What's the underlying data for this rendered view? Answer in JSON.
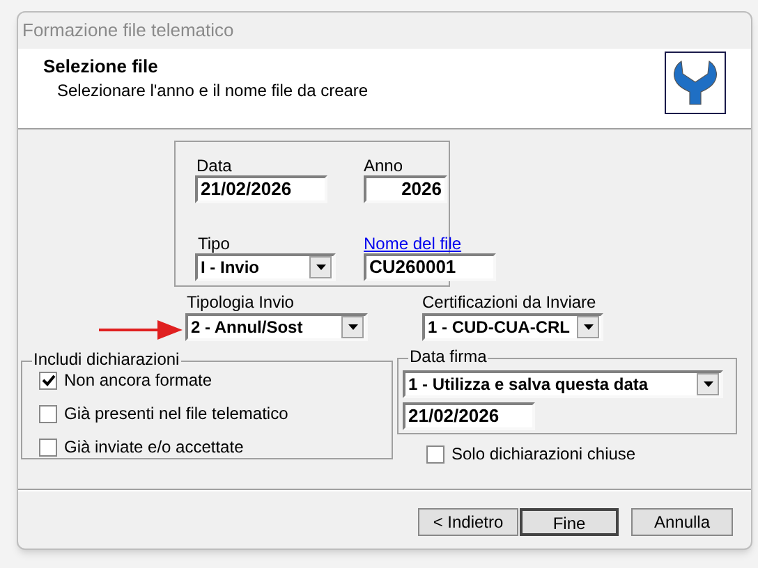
{
  "window": {
    "title": "Formazione file telematico"
  },
  "header": {
    "title": "Selezione file",
    "subtitle": "Selezionare l'anno e il nome file da creare"
  },
  "data": {
    "label": "Data",
    "value": "21/02/2026"
  },
  "anno": {
    "label": "Anno",
    "value": "2026"
  },
  "tipo": {
    "label": "Tipo",
    "value": "I - Invio"
  },
  "nome_file": {
    "label": "Nome del file",
    "value": "CU260001"
  },
  "tipologia_invio": {
    "label": "Tipologia Invio",
    "value": "2 - Annul/Sost"
  },
  "certificazioni": {
    "label": "Certificazioni da Inviare",
    "value": "1 - CUD-CUA-CRL"
  },
  "includi_dichiarazioni": {
    "title": "Includi dichiarazioni",
    "options": [
      {
        "label": "Non ancora formate",
        "checked": true
      },
      {
        "label": "Già presenti nel file telematico",
        "checked": false
      },
      {
        "label": "Già inviate e/o accettate",
        "checked": false
      }
    ]
  },
  "data_firma": {
    "title": "Data firma",
    "mode": "1 - Utilizza e salva questa data",
    "value": "21/02/2026"
  },
  "solo_chiuse": {
    "label": "Solo dichiarazioni chiuse",
    "checked": false
  },
  "buttons": [
    {
      "label": "< Indietro",
      "default": false
    },
    {
      "label": "Fine",
      "default": true
    },
    {
      "label": "Annulla",
      "default": false
    }
  ]
}
